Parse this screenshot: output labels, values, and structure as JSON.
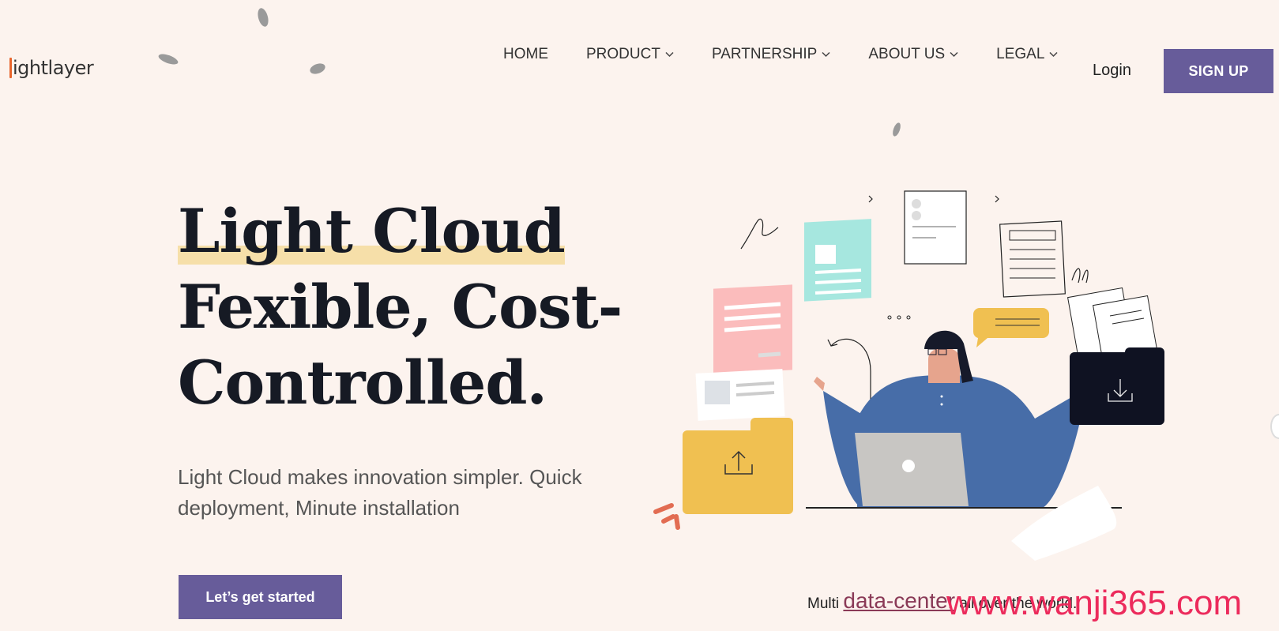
{
  "header": {
    "logo_text": "ightlayer",
    "nav": [
      {
        "label": "HOME",
        "dropdown": false
      },
      {
        "label": "PRODUCT",
        "dropdown": true
      },
      {
        "label": "PARTNERSHIP",
        "dropdown": true
      },
      {
        "label": "ABOUT US",
        "dropdown": true
      },
      {
        "label": "LEGAL",
        "dropdown": true
      }
    ],
    "login_label": "Login",
    "signup_label": "SIGN UP"
  },
  "hero": {
    "title_line1": "Light Cloud",
    "title_line2": "Fexible, Cost-",
    "title_line3": "Controlled.",
    "subtitle": "Light Cloud makes innovation simpler. Quick deployment, Minute installation",
    "cta_label": "Let’s get started"
  },
  "footer_note": {
    "prefix": "Multi ",
    "link": "data-center",
    "suffix": " all over the world."
  },
  "watermark": "www.wanji365.com",
  "colors": {
    "background": "#fcf3ee",
    "accent": "#675c9a",
    "highlight": "#f6dfa9",
    "illustration_blue": "#476da8",
    "illustration_yellow": "#f0c051",
    "illustration_pink": "#fbbcbc",
    "illustration_teal": "#a6e7df"
  }
}
